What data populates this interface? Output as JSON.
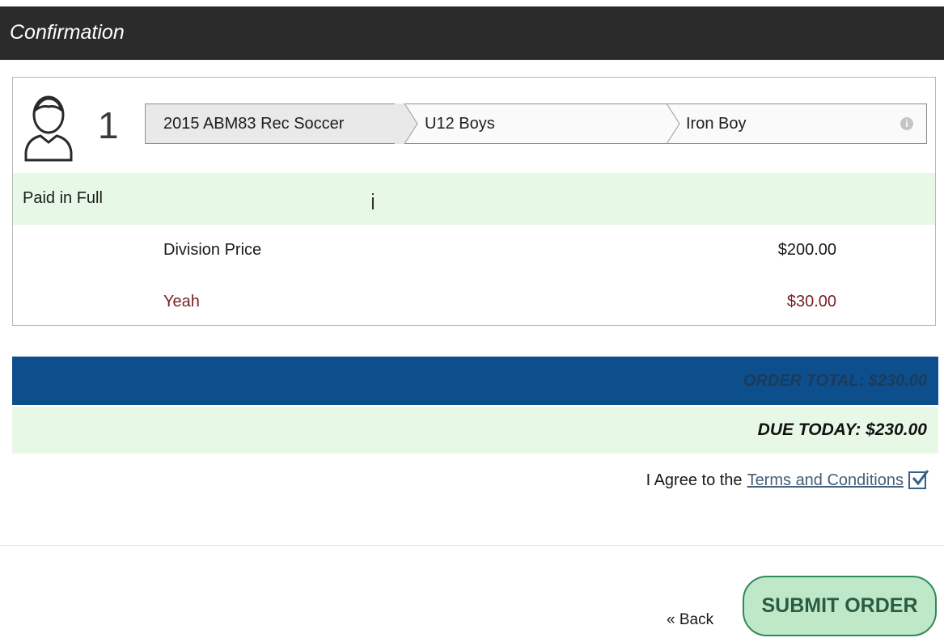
{
  "header": {
    "title": "Confirmation"
  },
  "participant": {
    "number": "1",
    "avatar_icon": "user-icon",
    "breadcrumb": [
      "2015 ABM83 Rec Soccer",
      "U12 Boys",
      "Iron Boy"
    ],
    "info_icon": "info-icon"
  },
  "plan": {
    "label": "Paid in Full"
  },
  "line_items": [
    {
      "name": "Division Price",
      "amount": "$200.00"
    },
    {
      "name": "Yeah",
      "amount": "$30.00"
    }
  ],
  "totals": {
    "order_total": "ORDER TOTAL: $230.00",
    "due_today": "DUE TODAY: $230.00"
  },
  "agreement": {
    "prefix": "I Agree to the",
    "link": "Terms and Conditions",
    "checked": true
  },
  "actions": {
    "back": "« Back",
    "submit": "SUBMIT ORDER"
  },
  "colors": {
    "header_bg": "#2b2b2b",
    "total_bar": "#0d4f8c",
    "highlight_green": "#e8f8e6",
    "submit_bg": "#bfe8c8"
  }
}
